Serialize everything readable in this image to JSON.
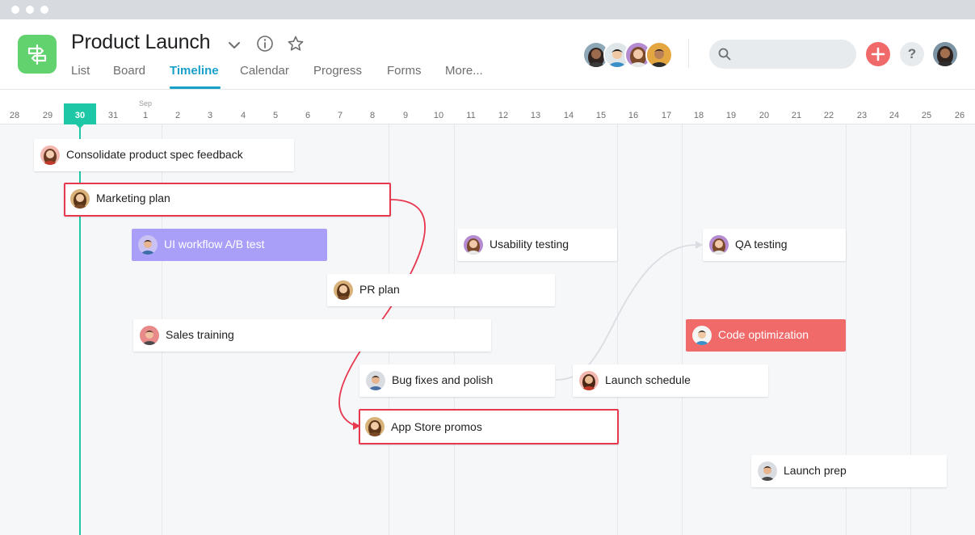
{
  "project": {
    "title": "Product Launch",
    "icon": "timeline-board-icon",
    "icon_color": "#62d26f"
  },
  "tabs": [
    {
      "label": "List",
      "active": false
    },
    {
      "label": "Board",
      "active": false
    },
    {
      "label": "Timeline",
      "active": true
    },
    {
      "label": "Calendar",
      "active": false
    },
    {
      "label": "Progress",
      "active": false
    },
    {
      "label": "Forms",
      "active": false
    },
    {
      "label": "More...",
      "active": false
    }
  ],
  "header_icons": [
    "chevron-down-icon",
    "info-icon",
    "star-icon"
  ],
  "members": [
    "member-avatar",
    "member-avatar",
    "member-avatar",
    "member-avatar"
  ],
  "search": {
    "placeholder": "",
    "icon": "search-icon"
  },
  "actions": {
    "add_icon": "plus-icon",
    "help_label": "?"
  },
  "timeline": {
    "month_label": "Sep",
    "today": "30",
    "days": [
      "28",
      "29",
      "30",
      "31",
      "1",
      "2",
      "3",
      "4",
      "5",
      "6",
      "7",
      "8",
      "9",
      "10",
      "11",
      "12",
      "13",
      "14",
      "15",
      "16",
      "17",
      "18",
      "19",
      "20",
      "21",
      "22",
      "23",
      "24",
      "25",
      "26"
    ]
  },
  "tasks": [
    {
      "label": "Consolidate product spec feedback",
      "style": "normal"
    },
    {
      "label": "Marketing plan",
      "style": "highlighted"
    },
    {
      "label": "UI workflow A/B test",
      "style": "purple"
    },
    {
      "label": "Usability testing",
      "style": "normal"
    },
    {
      "label": "QA testing",
      "style": "normal"
    },
    {
      "label": "PR plan",
      "style": "normal"
    },
    {
      "label": "Sales training",
      "style": "normal"
    },
    {
      "label": "Code optimization",
      "style": "coral"
    },
    {
      "label": "Bug fixes and polish",
      "style": "normal"
    },
    {
      "label": "Launch schedule",
      "style": "normal"
    },
    {
      "label": "App Store promos",
      "style": "highlighted"
    },
    {
      "label": "Launch prep",
      "style": "normal"
    }
  ],
  "colors": {
    "accent": "#1aa1c9",
    "today": "#1ec7a5",
    "highlight_border": "#e8384f",
    "purple_task": "#aa9ff8",
    "coral_task": "#f06a6a"
  }
}
